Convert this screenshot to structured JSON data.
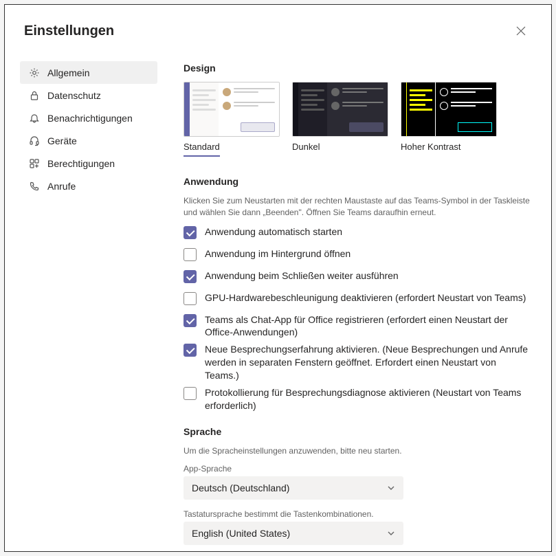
{
  "header": {
    "title": "Einstellungen"
  },
  "sidebar": {
    "items": [
      {
        "label": "Allgemein"
      },
      {
        "label": "Datenschutz"
      },
      {
        "label": "Benachrichtigungen"
      },
      {
        "label": "Geräte"
      },
      {
        "label": "Berechtigungen"
      },
      {
        "label": "Anrufe"
      }
    ]
  },
  "design": {
    "title": "Design",
    "themes": [
      {
        "label": "Standard"
      },
      {
        "label": "Dunkel"
      },
      {
        "label": "Hoher Kontrast"
      }
    ]
  },
  "application": {
    "title": "Anwendung",
    "hint": "Klicken Sie zum Neustarten mit der rechten Maustaste auf das Teams-Symbol in der Taskleiste und wählen Sie dann „Beenden\". Öffnen Sie Teams daraufhin erneut.",
    "options": [
      {
        "label": "Anwendung automatisch starten",
        "checked": true
      },
      {
        "label": "Anwendung im Hintergrund öffnen",
        "checked": false
      },
      {
        "label": "Anwendung beim Schließen weiter ausführen",
        "checked": true
      },
      {
        "label": "GPU-Hardwarebeschleunigung deaktivieren (erfordert Neustart von Teams)",
        "checked": false
      },
      {
        "label": "Teams als Chat-App für Office registrieren (erfordert einen Neustart der Office-Anwendungen)",
        "checked": true
      },
      {
        "label": "Neue Besprechungserfahrung aktivieren. (Neue Besprechungen und Anrufe werden in separaten Fenstern geöffnet. Erfordert einen Neustart von Teams.)",
        "checked": true
      },
      {
        "label": "Protokollierung für Besprechungsdiagnose aktivieren (Neustart von Teams erforderlich)",
        "checked": false
      }
    ]
  },
  "language": {
    "title": "Sprache",
    "hint": "Um die Spracheinstellungen anzuwenden, bitte neu starten.",
    "app_label": "App-Sprache",
    "app_value": "Deutsch (Deutschland)",
    "kb_label": "Tastatursprache bestimmt die Tastenkombinationen.",
    "kb_value": "English (United States)"
  }
}
